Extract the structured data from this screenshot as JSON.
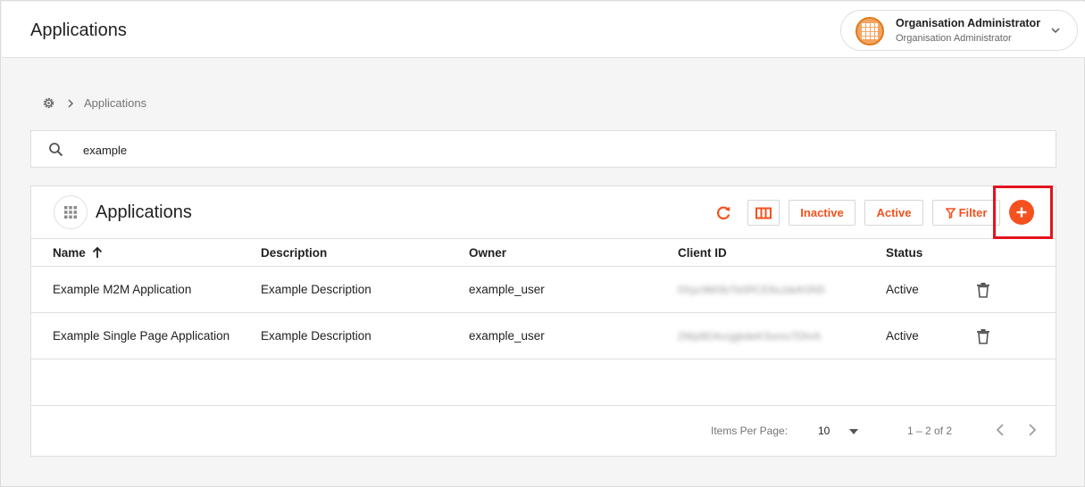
{
  "header": {
    "title": "Applications",
    "user": {
      "name": "Organisation Administrator",
      "role": "Organisation Administrator"
    }
  },
  "breadcrumb": {
    "current": "Applications"
  },
  "search": {
    "value": "example"
  },
  "card": {
    "title": "Applications",
    "buttons": {
      "inactive": "Inactive",
      "active": "Active",
      "filter": "Filter"
    }
  },
  "table": {
    "columns": [
      "Name",
      "Description",
      "Owner",
      "Client ID",
      "Status"
    ],
    "rows": [
      {
        "name": "Example M2M Application",
        "description": "Example Description",
        "owner": "example_user",
        "client_id": "0Xpc9M3b7b0RCE6sJdeK0N5",
        "status": "Active"
      },
      {
        "name": "Example Single Page Application",
        "description": "Example Description",
        "owner": "example_user",
        "client_id": "2Wp9D4vcjgbdeK3omo7DhrA",
        "status": "Active"
      }
    ]
  },
  "paginator": {
    "items_per_page_label": "Items Per Page:",
    "items_per_page": "10",
    "range": "1 – 2 of 2"
  },
  "colors": {
    "accent": "#f4511e",
    "highlight": "#e3131e"
  }
}
